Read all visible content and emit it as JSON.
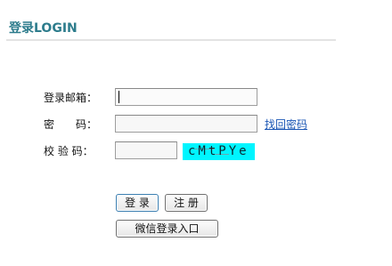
{
  "header": {
    "title": "登录LOGIN"
  },
  "form": {
    "email_label": "登录邮箱：",
    "email_value": "",
    "password_label": "密　　码：",
    "password_value": "",
    "forgot_link": "找回密码",
    "code_label": "校 验 码：",
    "code_value": "",
    "captcha_text": "cMtPYe"
  },
  "buttons": {
    "login": "登 录",
    "register": "注 册",
    "wechat": "微信登录入口"
  },
  "colors": {
    "heading": "#2d7c8c",
    "link": "#1b57b5",
    "captcha_bg": "#00f5ff"
  }
}
